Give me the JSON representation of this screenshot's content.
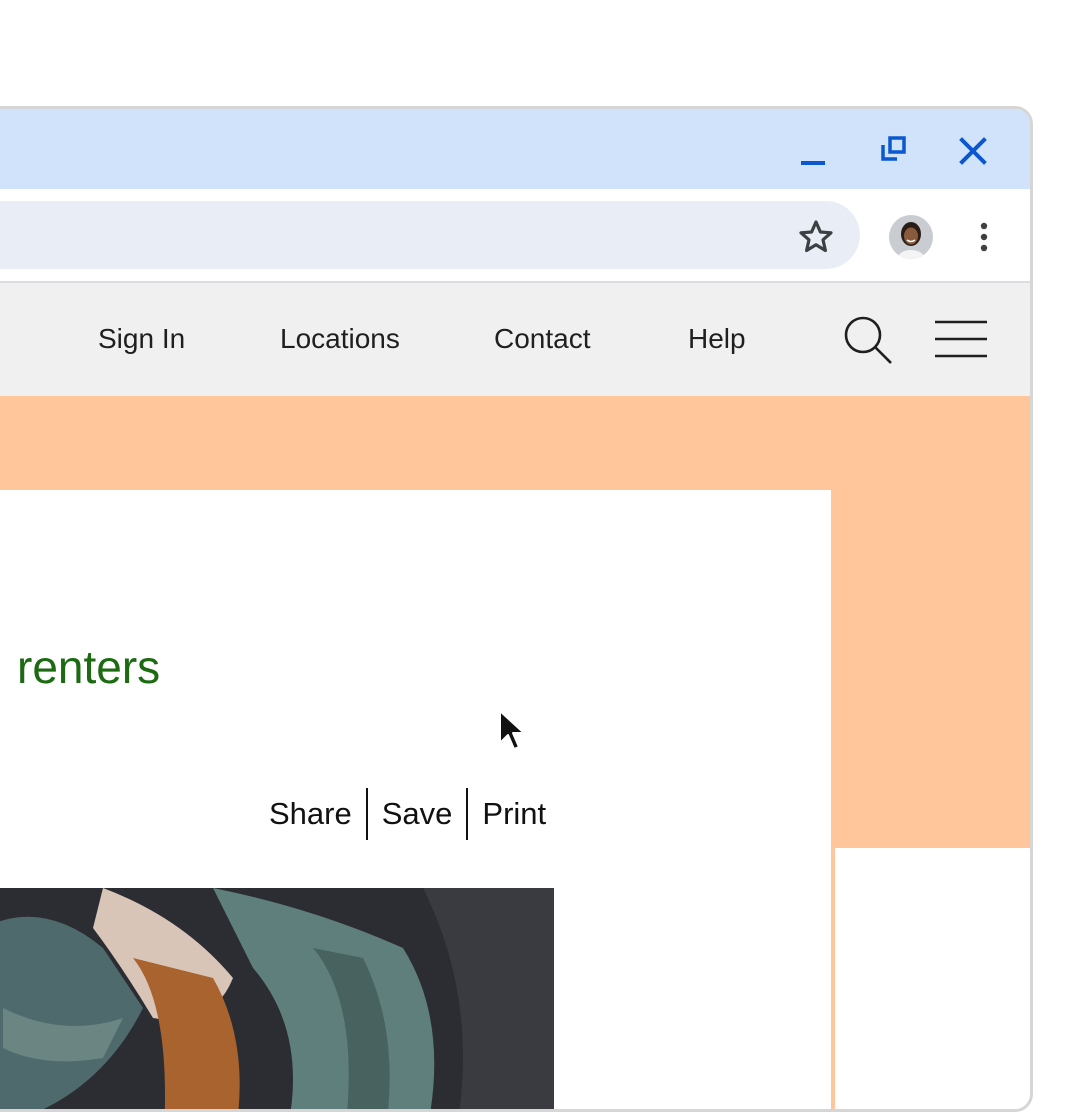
{
  "window": {
    "controls": {
      "minimize": "minimize-icon",
      "restore": "restore-icon",
      "close": "close-icon"
    },
    "accent_color": "#0b57d0"
  },
  "toolbar": {
    "bookmark_icon": "star-icon",
    "profile_icon": "avatar",
    "menu_icon": "kebab-menu-icon"
  },
  "site_nav": {
    "links": [
      "Sign In",
      "Locations",
      "Contact",
      "Help"
    ],
    "search_icon": "search-icon",
    "menu_icon": "hamburger-icon"
  },
  "article": {
    "headline": "renters",
    "headline_color": "#1c6a12",
    "actions": [
      "Share",
      "Save",
      "Print"
    ]
  },
  "colors": {
    "page_background": "#ffc69c",
    "nav_background": "#f0f0f0",
    "titlebar": "#d1e3fa",
    "omnibox": "#e9eef6"
  }
}
